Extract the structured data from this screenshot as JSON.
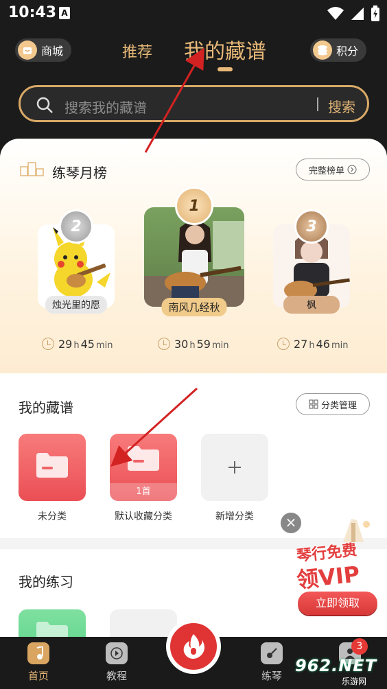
{
  "status_bar": {
    "time": "10:43",
    "a_icon": "A"
  },
  "header": {
    "shop_label": "商城",
    "points_label": "积分",
    "tabs": [
      {
        "label": "推荐",
        "active": false
      },
      {
        "label": "我的藏谱",
        "active": true
      }
    ]
  },
  "search": {
    "placeholder": "搜索我的藏谱",
    "button": "搜索"
  },
  "ranking": {
    "title": "练琴月榜",
    "full_list": "完整榜单",
    "items": [
      {
        "rank": "2",
        "name": "烛光里的愿",
        "hours": "29",
        "minutes": "45",
        "h_unit": "h",
        "min_unit": "min"
      },
      {
        "rank": "1",
        "name": "南风几经秋",
        "hours": "30",
        "minutes": "59",
        "h_unit": "h",
        "min_unit": "min"
      },
      {
        "rank": "3",
        "name": "枫",
        "hours": "27",
        "minutes": "46",
        "h_unit": "h",
        "min_unit": "min"
      }
    ]
  },
  "collections": {
    "title": "我的藏谱",
    "manage": "分类管理",
    "folders": [
      {
        "label": "未分类",
        "count": ""
      },
      {
        "label": "默认收藏分类",
        "count": "1首"
      },
      {
        "label": "新增分类",
        "count": ""
      }
    ]
  },
  "practice": {
    "title": "我的练习"
  },
  "vip_promo": {
    "line1": "琴行免费",
    "line2": "领VIP",
    "button": "立即领取",
    "close": "×"
  },
  "bottom_nav": {
    "items": [
      {
        "label": "首页",
        "active": true
      },
      {
        "label": "教程",
        "active": false
      },
      {
        "label": "练琴",
        "active": false
      },
      {
        "label": "",
        "active": false
      }
    ],
    "badge_count": "3"
  },
  "watermark": {
    "number": "962.NET",
    "sub": "乐游网"
  },
  "colors": {
    "gold": "#e6b878",
    "red": "#e03434",
    "dark": "#1b1b1b"
  }
}
